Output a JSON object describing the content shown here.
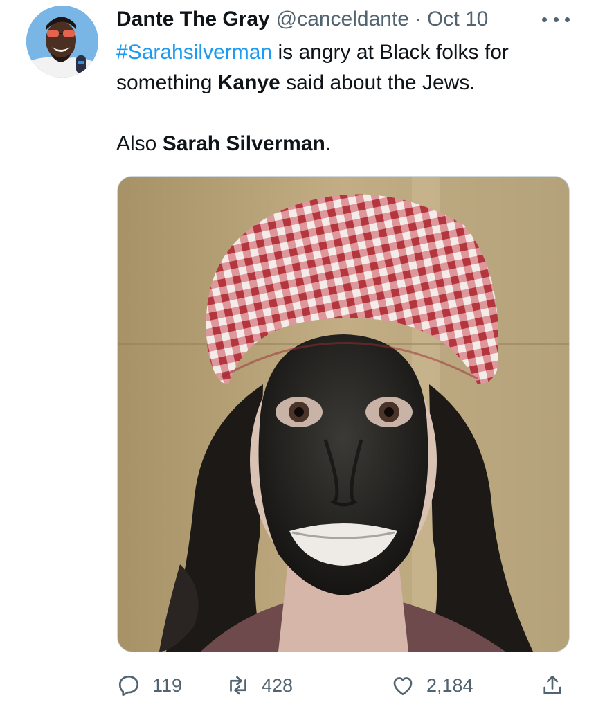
{
  "author": {
    "display_name": "Dante The Gray",
    "handle": "@canceldante",
    "separator": "·",
    "date": "Oct 10"
  },
  "tweet": {
    "hashtag": "#Sarahsilverman",
    "line1_rest": " is angry at Black folks for",
    "line2_pre": "something ",
    "line2_bold": "Kanye",
    "line2_post": " said about the Jews.",
    "para2_pre": "Also ",
    "para2_bold": "Sarah Silverman",
    "para2_post": "."
  },
  "actions": {
    "replies": "119",
    "retweets": "428",
    "likes": "2,184"
  },
  "icons": {
    "more": "more-icon",
    "reply": "reply-icon",
    "retweet": "retweet-icon",
    "like": "heart-icon",
    "share": "share-icon"
  },
  "colors": {
    "link": "#1d9bf0",
    "secondary_text": "#536471",
    "primary_text": "#0f1419",
    "border": "#cfd9de"
  }
}
